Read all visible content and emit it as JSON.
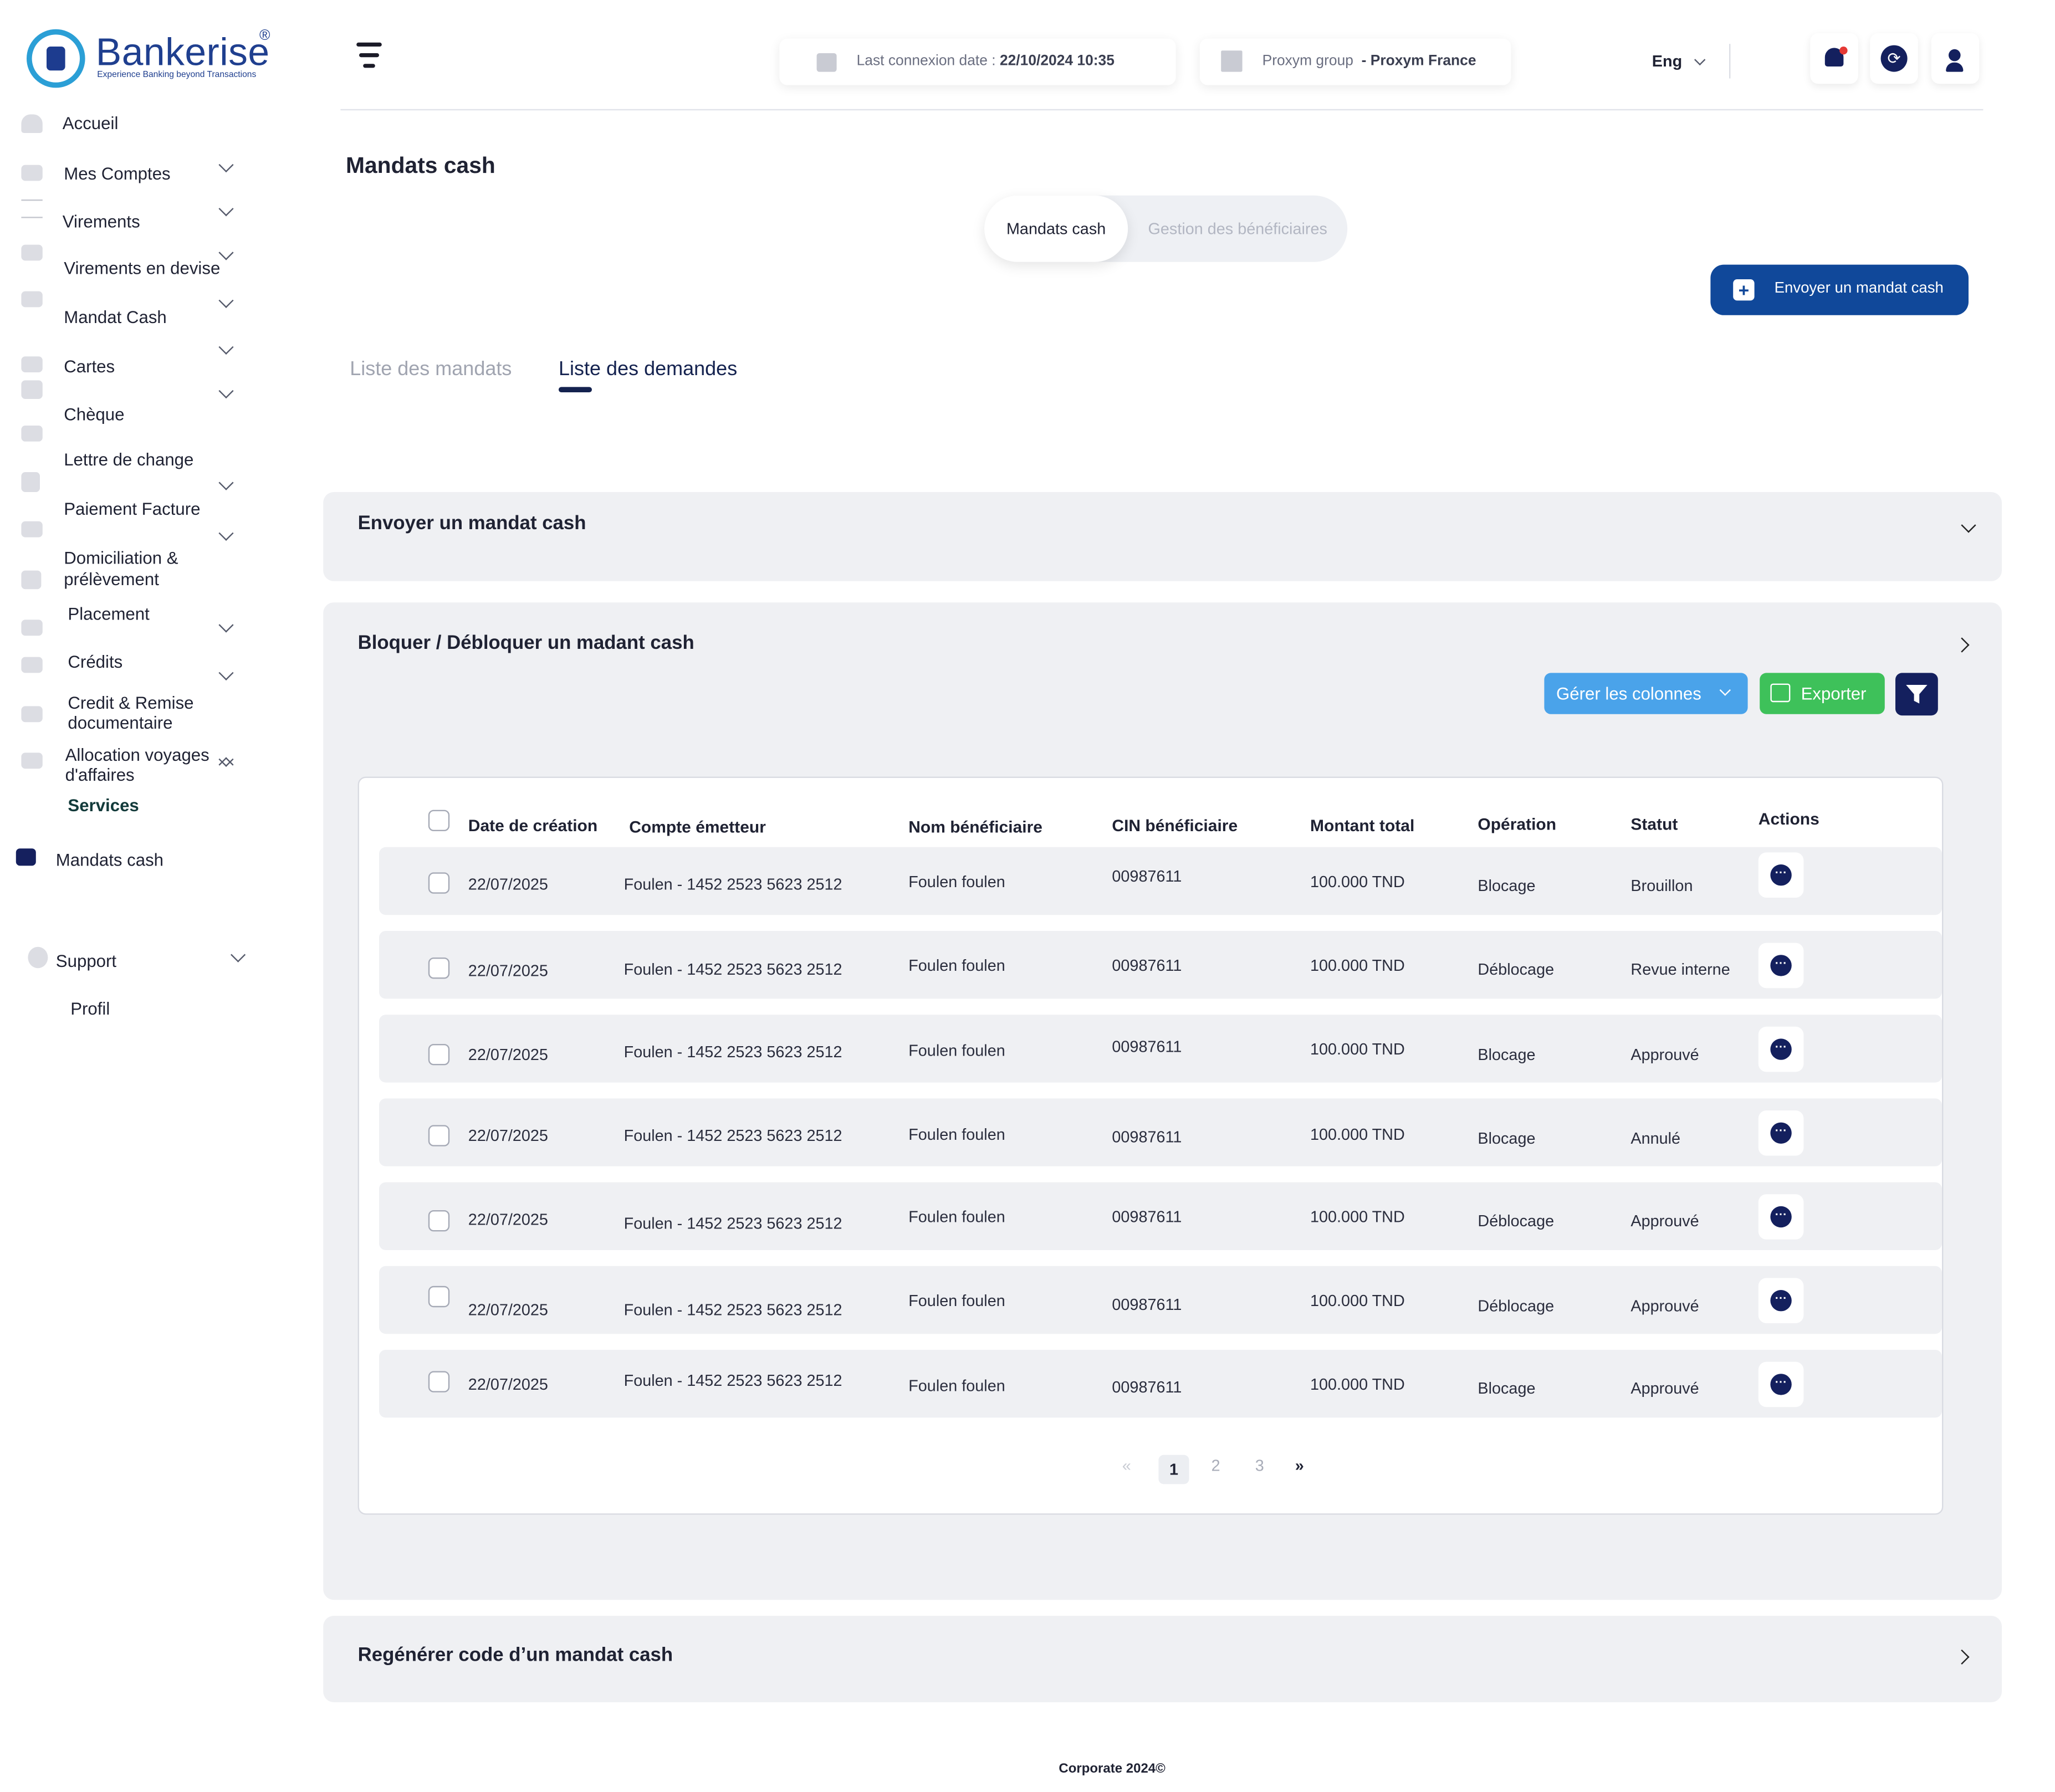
{
  "brand": {
    "name": "Bankerise",
    "registered": "®",
    "tagline": "Experience Banking beyond Transactions"
  },
  "sidebar": {
    "items": [
      {
        "label": "Accueil"
      },
      {
        "label": "Mes Comptes"
      },
      {
        "label": "Virements"
      },
      {
        "label": "Virements en devise"
      },
      {
        "label": "Mandat Cash"
      },
      {
        "label": "Cartes"
      },
      {
        "label": "Chèque"
      },
      {
        "label": "Lettre de change"
      },
      {
        "label": "Paiement Facture"
      },
      {
        "label": "Domiciliation &",
        "label2": "prélèvement"
      },
      {
        "label": "Placement"
      },
      {
        "label": "Crédits"
      },
      {
        "label": "Credit & Remise",
        "label2": "documentaire"
      },
      {
        "label": "Allocation  voyages",
        "label2": "d'affaires"
      }
    ],
    "section": "Services",
    "active_item": "Mandats cash",
    "support": "Support",
    "profil": "Profil"
  },
  "header": {
    "last_connexion_label": "Last connexion date :",
    "last_connexion_value": "22/10/2024 10:35",
    "group_label": "Proxym group",
    "group_value": "- Proxym France",
    "language": "Eng"
  },
  "page": {
    "title": "Mandats cash",
    "segments": [
      "Mandats cash",
      "Gestion des bénéficiaires"
    ],
    "send_button": "Envoyer un mandat cash",
    "tabs": [
      "Liste des mandats",
      "Liste des demandes"
    ]
  },
  "panels": {
    "send": "Envoyer un mandat cash",
    "block": "Bloquer / Débloquer un madant cash",
    "regen": "Regénérer code d’un mandat cash"
  },
  "toolbar": {
    "columns": "Gérer les colonnes",
    "export": "Exporter"
  },
  "table": {
    "headers": [
      "Date de création",
      "Compte émetteur",
      "Nom bénéficiaire",
      "CIN  bénéficiaire",
      "Montant total",
      "Opération",
      "Statut",
      "Actions"
    ],
    "rows": [
      [
        "22/07/2025",
        "Foulen - 1452 2523 5623 2512",
        "Foulen foulen",
        "00987611",
        "100.000 TND",
        "Blocage",
        "Brouillon"
      ],
      [
        "22/07/2025",
        "Foulen - 1452 2523 5623 2512",
        "Foulen foulen",
        "00987611",
        "100.000 TND",
        "Déblocage",
        "Revue interne"
      ],
      [
        "22/07/2025",
        "Foulen - 1452 2523 5623 2512",
        "Foulen foulen",
        "00987611",
        "100.000 TND",
        "Blocage",
        "Approuvé"
      ],
      [
        "22/07/2025",
        "Foulen - 1452 2523 5623 2512",
        "Foulen foulen",
        "00987611",
        "100.000 TND",
        "Blocage",
        "Annulé"
      ],
      [
        "22/07/2025",
        "Foulen - 1452 2523 5623 2512",
        "Foulen foulen",
        "00987611",
        "100.000 TND",
        "Déblocage",
        "Approuvé"
      ],
      [
        "22/07/2025",
        "Foulen - 1452 2523 5623 2512",
        "Foulen foulen",
        "00987611",
        "100.000 TND",
        "Déblocage",
        "Approuvé"
      ],
      [
        "22/07/2025",
        "Foulen - 1452 2523 5623 2512",
        "Foulen foulen",
        "00987611",
        "100.000 TND",
        "Blocage",
        "Approuvé"
      ]
    ]
  },
  "pagination": {
    "first": "«",
    "pages": [
      "1",
      "2",
      "3"
    ],
    "last": "»",
    "current": "1"
  },
  "footer": "Corporate 2024©",
  "colors": {
    "primary": "#10489a",
    "columns_btn": "#4aa3ea",
    "export_btn": "#3ec15a",
    "filter_btn": "#14205e",
    "panel_bg": "#eff0f3"
  }
}
